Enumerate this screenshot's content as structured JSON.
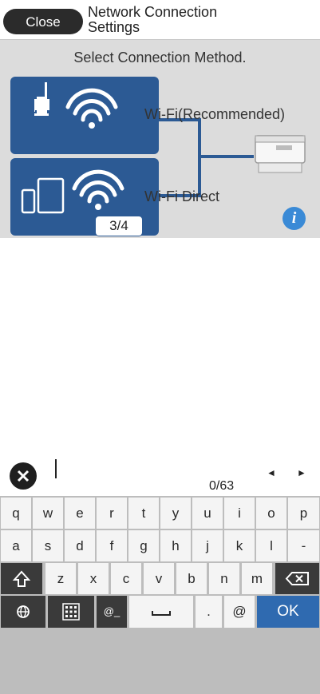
{
  "connection_screen": {
    "close_label": "Close",
    "title": "Network Connection Settings",
    "prompt": "Select Connection Method.",
    "options": [
      {
        "label": "Wi-Fi(Recommended)",
        "icon": "router-wifi-icon"
      },
      {
        "label": "Wi-Fi Direct",
        "icon": "devices-wifi-icon"
      }
    ],
    "page_indicator": "3/4",
    "info_label": "i",
    "accent_color": "#2c5a94"
  },
  "keyboard_screen": {
    "char_count": "0/63",
    "left_arrow": "◄",
    "right_arrow": "►",
    "row1": [
      "q",
      "w",
      "e",
      "r",
      "t",
      "y",
      "u",
      "i",
      "o",
      "p"
    ],
    "row2": [
      "a",
      "s",
      "d",
      "f",
      "g",
      "h",
      "j",
      "k",
      "l",
      "-"
    ],
    "row3": [
      "z",
      "x",
      "c",
      "v",
      "b",
      "n",
      "m"
    ],
    "bottom": {
      "symbols": "@_",
      "period": ".",
      "at": "@",
      "ok": "OK"
    },
    "ok_color": "#2f6ab0"
  }
}
